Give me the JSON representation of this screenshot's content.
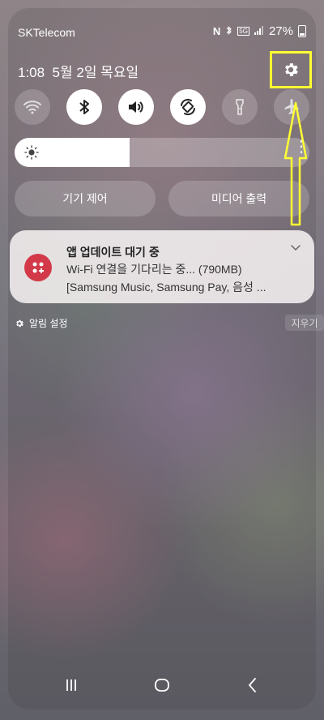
{
  "status_bar": {
    "carrier": "SKTelecom",
    "battery_percent": "27%",
    "icons": [
      "nfc-icon",
      "bluetooth-icon",
      "5g-icon",
      "signal-icon",
      "battery-icon"
    ],
    "network_label": "5G"
  },
  "header": {
    "time": "1:08",
    "date": "5월 2일 목요일"
  },
  "quick_tiles": [
    {
      "icon": "wifi-icon",
      "state": "off"
    },
    {
      "icon": "bluetooth-icon",
      "state": "on"
    },
    {
      "icon": "sound-icon",
      "state": "on"
    },
    {
      "icon": "auto-rotate-icon",
      "state": "on"
    },
    {
      "icon": "flashlight-icon",
      "state": "off"
    },
    {
      "icon": "airplane-icon",
      "state": "off"
    }
  ],
  "brightness": {
    "level": 0.39
  },
  "controls": {
    "device_control": "기기 제어",
    "media_output": "미디어 출력"
  },
  "notification": {
    "title": "앱 업데이트 대기 중",
    "line1": "Wi-Fi 연결을 기다리는 중... (790MB)",
    "line2": "[Samsung Music, Samsung Pay, 음성 ..."
  },
  "footer": {
    "notification_settings": "알림 설정",
    "clear": "지우기"
  },
  "colors": {
    "highlight": "#ffff33",
    "notification_icon": "#d33a49"
  }
}
